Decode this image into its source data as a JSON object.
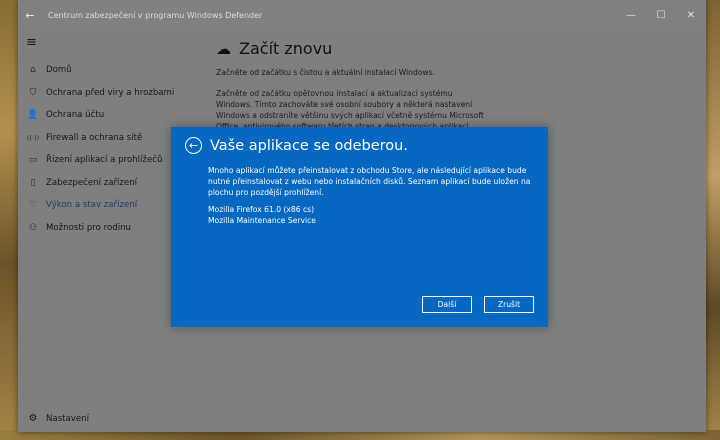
{
  "window": {
    "title": "Centrum zabezpečení v programu Windows Defender",
    "back_glyph": "←",
    "controls": {
      "minimize": "—",
      "maximize": "☐",
      "close": "✕"
    }
  },
  "sidebar": {
    "menu_glyph": "≡",
    "items": [
      {
        "icon": "⌂",
        "label": "Domů"
      },
      {
        "icon": "⛉",
        "label": "Ochrana před viry a hrozbami"
      },
      {
        "icon": "👤",
        "label": "Ochrana účtu"
      },
      {
        "icon": "((·))",
        "label": "Firewall a ochrana sítě"
      },
      {
        "icon": "▭",
        "label": "Řízení aplikací a prohlížečů"
      },
      {
        "icon": "▯",
        "label": "Zabezpečení zařízení"
      },
      {
        "icon": "♡",
        "label": "Výkon a stav zařízení"
      },
      {
        "icon": "⚇",
        "label": "Možnosti pro rodinu"
      }
    ],
    "active_index": 6,
    "settings": {
      "icon": "⚙",
      "label": "Nastavení"
    }
  },
  "content": {
    "title": "Začít znovu",
    "title_icon": "☁",
    "paragraph1": "Začněte od začátku s čistou a aktuální instalací Windows.",
    "paragraph2": "Začněte od začátku opětovnou instalací a aktualizací systému Windows. Tímto zachováte své osobní soubory a některá nastavení Windows a odstraníte většinu svých aplikací včetně systému Microsoft Office, antivirového softwaru třetích stran a desktopových aplikací, které byly na"
  },
  "dialog": {
    "back_glyph": "←",
    "title": "Vaše aplikace se odeberou.",
    "body": "Mnoho aplikací můžete přeinstalovat z obchodu Store, ale následující aplikace bude nutné přeinstalovat z webu nebo instalačních disků. Seznam aplikací bude uložen na plochu pro pozdější prohlížení.",
    "apps": [
      "Mozilla Firefox 61.0 (x86 cs)",
      "Mozilla Maintenance Service"
    ],
    "next_label": "Další",
    "cancel_label": "Zrušit",
    "accent_color": "#0668c0"
  }
}
